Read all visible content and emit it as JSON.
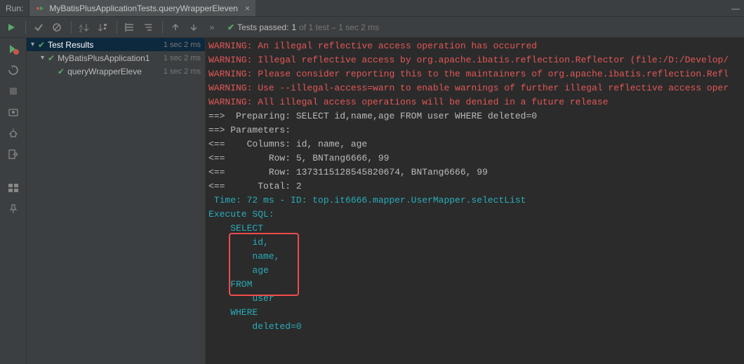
{
  "header": {
    "run_label": "Run:",
    "tab_title": "MyBatisPlusApplicationTests.queryWrapperEleven",
    "tab_close": "×",
    "minimize": "—"
  },
  "toolbar": {
    "tests_prefix": "Tests passed:",
    "tests_passed_count": "1",
    "tests_passed_detail": "of 1 test – 1 sec 2 ms"
  },
  "tree": {
    "root": {
      "label": "Test Results",
      "time": "1 sec 2 ms"
    },
    "node1": {
      "label": "MyBatisPlusApplication1",
      "time": "1 sec 2 ms"
    },
    "node2": {
      "label": "queryWrapperEleve",
      "time": "1 sec 2 ms"
    }
  },
  "console": {
    "l0": "WARNING: An illegal reflective access operation has occurred",
    "l1": "WARNING: Illegal reflective access by org.apache.ibatis.reflection.Reflector (file:/D:/Develop/",
    "l2": "WARNING: Please consider reporting this to the maintainers of org.apache.ibatis.reflection.Refl",
    "l3": "WARNING: Use --illegal-access=warn to enable warnings of further illegal reflective access oper",
    "l4": "WARNING: All illegal access operations will be denied in a future release",
    "l5": "==>  Preparing: SELECT id,name,age FROM user WHERE deleted=0",
    "l6": "==> Parameters: ",
    "l7": "<==    Columns: id, name, age",
    "l8": "<==        Row: 5, BNTang6666, 99",
    "l9": "<==        Row: 1373115128545820674, BNTang6666, 99",
    "l10": "<==      Total: 2",
    "l11": " Time: 72 ms - ID: top.it6666.mapper.UserMapper.selectList",
    "l12": "Execute SQL:",
    "l13": "    SELECT",
    "l14": "        id,",
    "l15": "        name,",
    "l16": "        age ",
    "l17": "    FROM",
    "l18": "        user ",
    "l19": "    WHERE",
    "l20": "        deleted=0"
  }
}
